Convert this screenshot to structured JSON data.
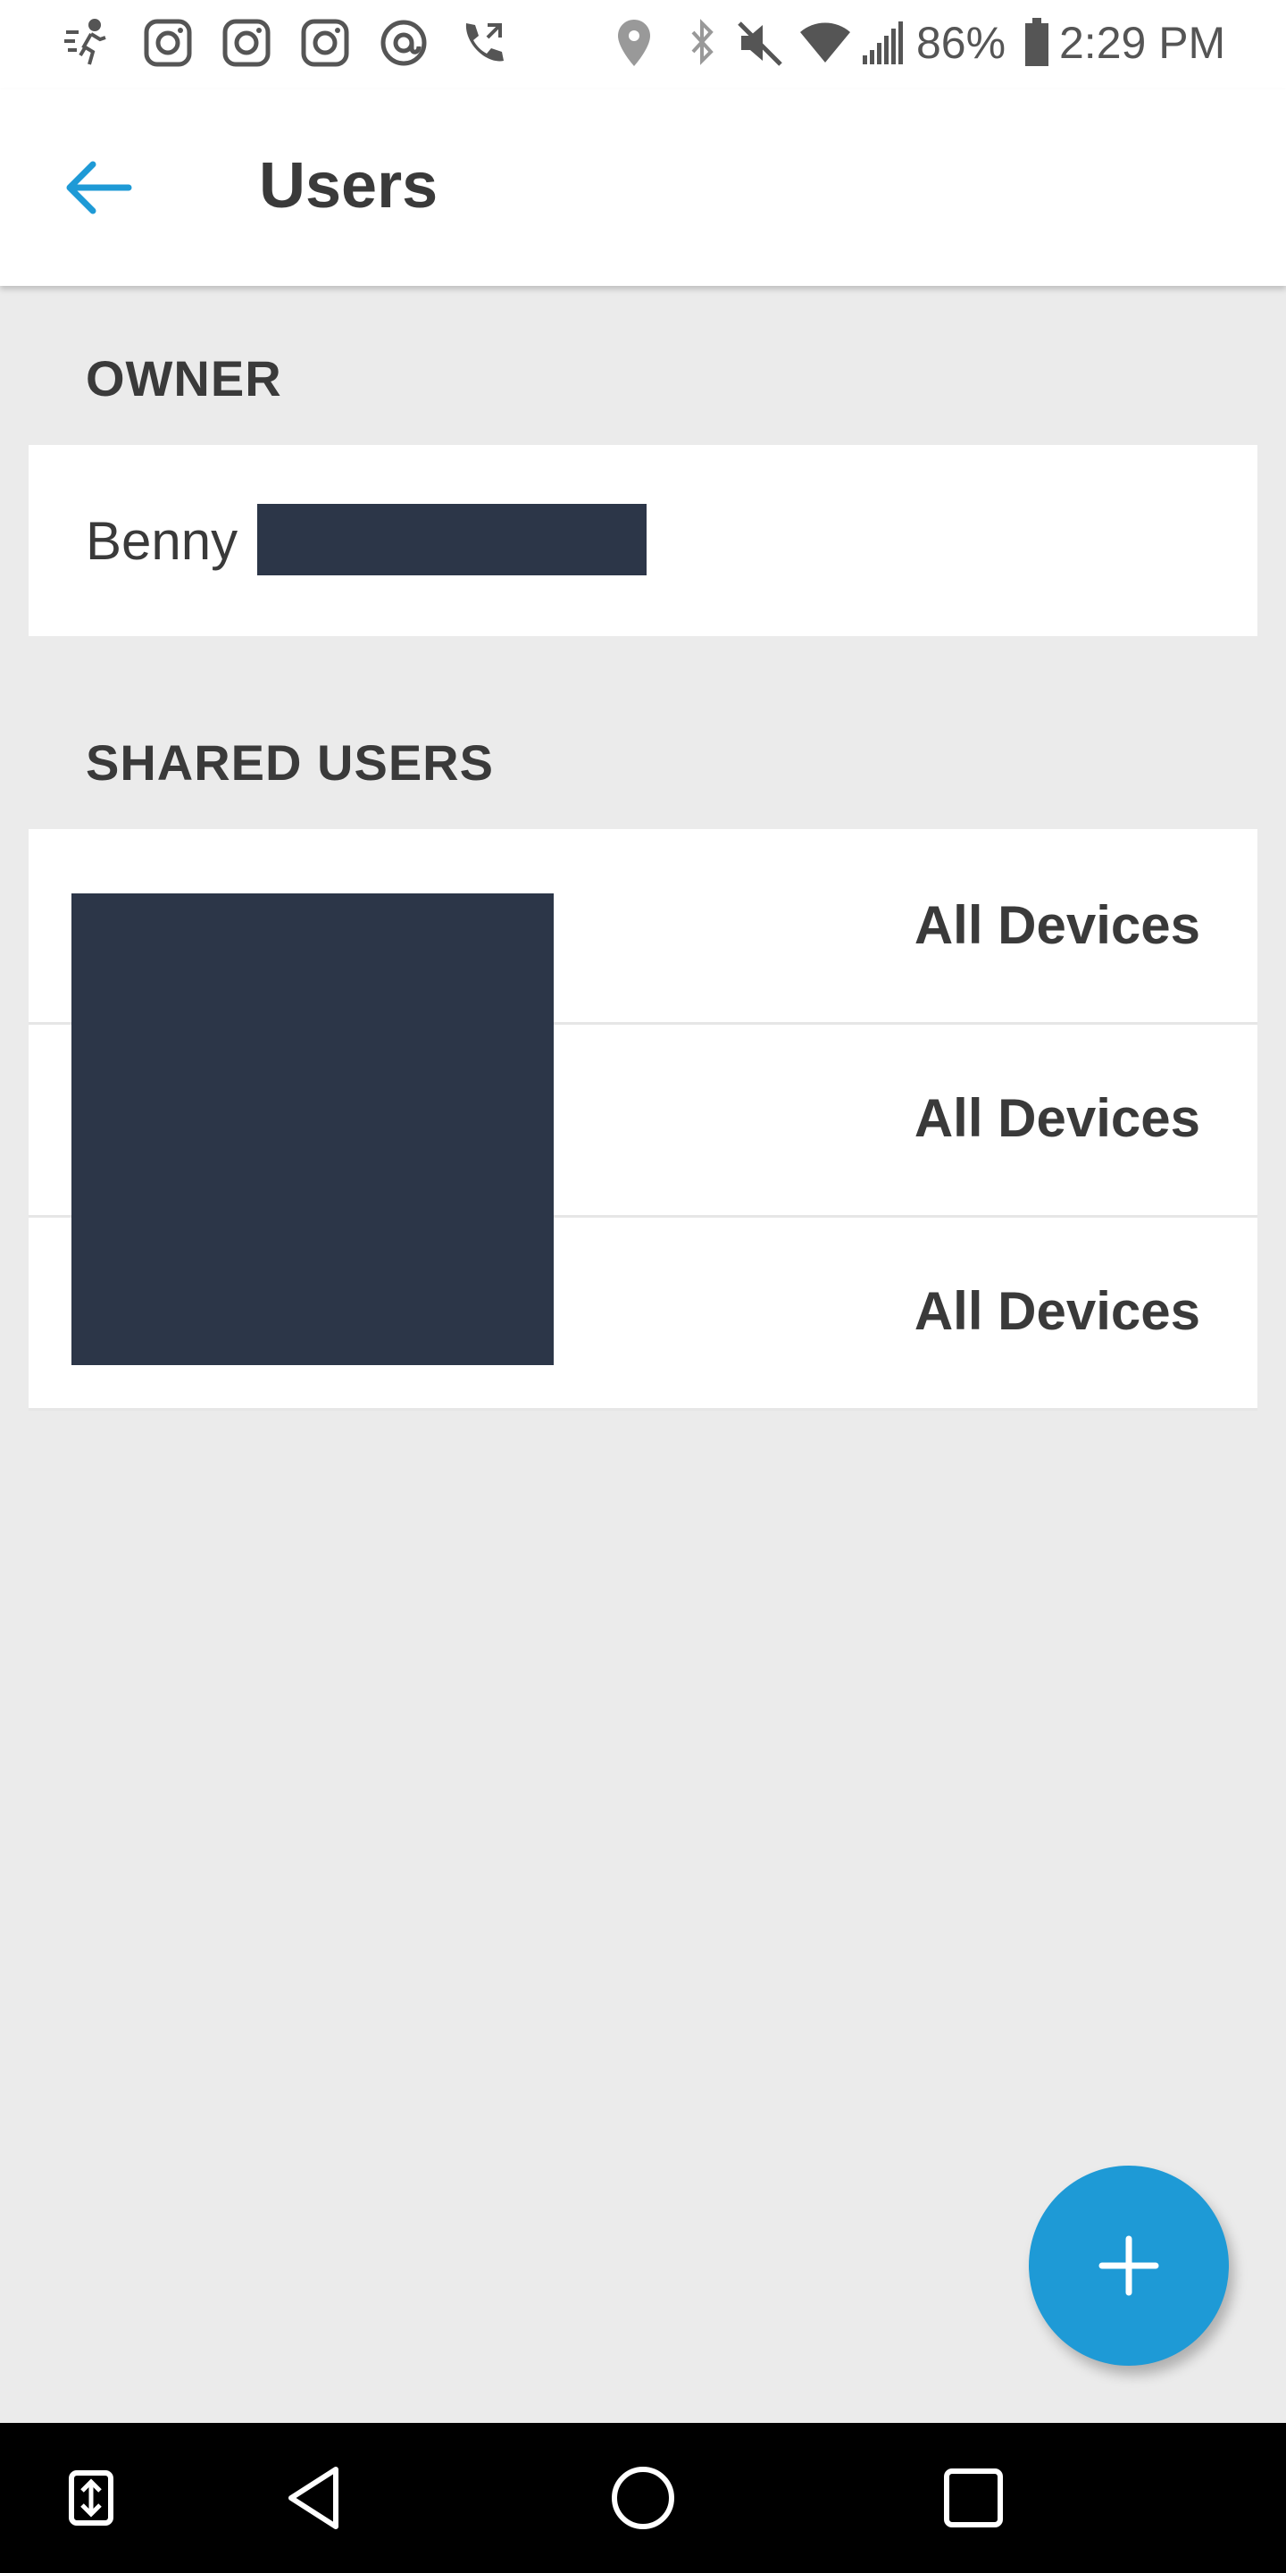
{
  "status_bar": {
    "battery": "86%",
    "time": "2:29 PM",
    "icons_left": [
      "activity-icon",
      "instagram-icon",
      "instagram-icon",
      "instagram-icon",
      "threads-icon",
      "call-forward-icon"
    ],
    "icons_right": [
      "location-icon",
      "bluetooth-icon",
      "mute-icon",
      "wifi-icon",
      "signal-icon",
      "battery-icon"
    ]
  },
  "header": {
    "title": "Users",
    "back_icon": "arrow-left-icon"
  },
  "owner_section": {
    "title": "OWNER",
    "name": "Benny"
  },
  "shared_section": {
    "title": "SHARED USERS",
    "rows": [
      {
        "access": "All Devices"
      },
      {
        "access": "All Devices"
      },
      {
        "access": "All Devices"
      }
    ]
  },
  "fab": {
    "icon": "plus-icon"
  },
  "nav_bar": {
    "icons": [
      "screen-switch-icon",
      "back-icon",
      "home-icon",
      "recents-icon"
    ]
  },
  "colors": {
    "accent": "#1e9ad6",
    "background": "#ebebeb",
    "redaction": "#2c3648"
  }
}
